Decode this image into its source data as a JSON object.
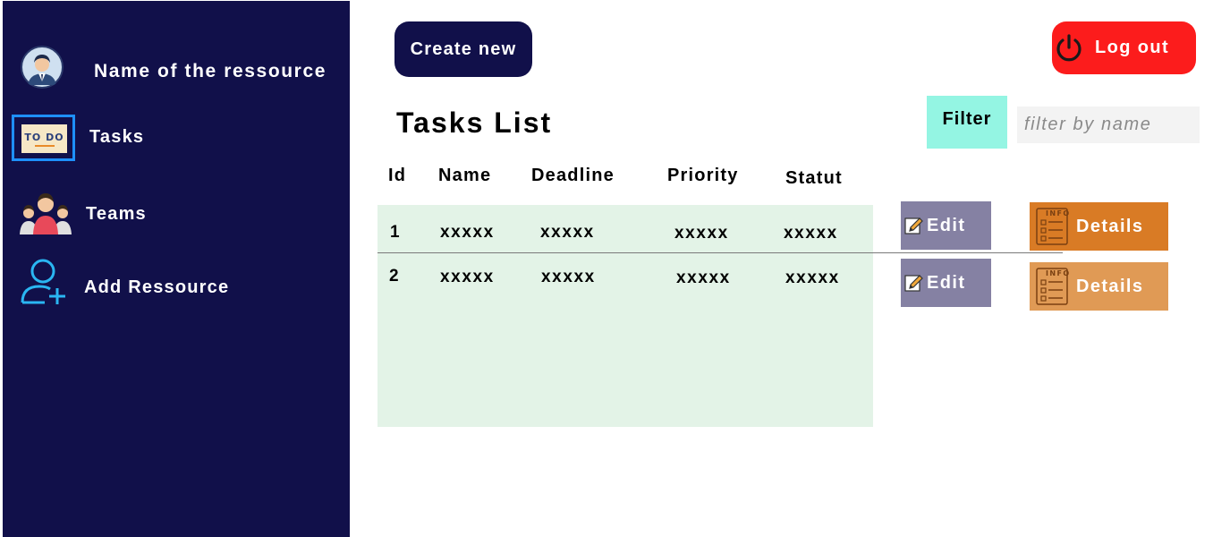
{
  "sidebar": {
    "user_name": "Name of the ressource",
    "items": [
      {
        "label": "Tasks",
        "icon": "todo-icon"
      },
      {
        "label": "Teams",
        "icon": "team-icon"
      },
      {
        "label": "Add Ressource",
        "icon": "add-user-icon"
      }
    ],
    "todo_icon_text": "TO DO",
    "bg_color": "#11104a"
  },
  "header": {
    "create_label": "Create new",
    "logout_label": "Log out"
  },
  "main": {
    "title": "Tasks List",
    "filter_label": "Filter",
    "filter_placeholder": "filter by name"
  },
  "table": {
    "columns": [
      "Id",
      "Name",
      "Deadline",
      "Priority",
      "Statut"
    ],
    "rows": [
      {
        "id": "1",
        "name": "xxxxx",
        "deadline": "xxxxx",
        "priority": "xxxxx",
        "statut": "xxxxx"
      },
      {
        "id": "2",
        "name": "xxxxx",
        "deadline": "xxxxx",
        "priority": "xxxxx",
        "statut": "xxxxx"
      }
    ],
    "edit_label": "Edit",
    "details_label": "Details",
    "details_icon_text": "INFO"
  },
  "colors": {
    "accent_dark": "#11104a",
    "logout": "#fc1c1c",
    "filter": "#94f5e3",
    "edit": "#8581a3",
    "details_primary": "#d97b25",
    "details_secondary": "#e09a55",
    "table_bg": "#e3f3e7"
  }
}
